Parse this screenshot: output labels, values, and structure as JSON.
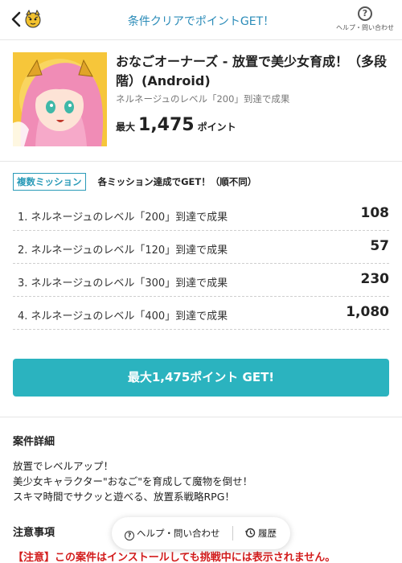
{
  "header": {
    "title": "条件クリアでポイントGET！",
    "help_icon_glyph": "?",
    "help_label": "ヘルプ・問い合わせ",
    "mascot_icon": "tiger-mascot-icon"
  },
  "app": {
    "title": "おなごオーナーズ - 放置で美少女育成！（多段階）(Android)",
    "subtitle": "ネルネージュのレベル「200」到達で成果",
    "max_prefix": "最大",
    "max_points": "1,475",
    "points_unit": "ポイント"
  },
  "missions": {
    "badge": "複数ミッション",
    "note": "各ミッション達成でGET！（順不同）",
    "items": [
      {
        "label": "1. ネルネージュのレベル「200」到達で成果",
        "points": "108"
      },
      {
        "label": "2. ネルネージュのレベル「120」到達で成果",
        "points": "57"
      },
      {
        "label": "3. ネルネージュのレベル「300」到達で成果",
        "points": "230"
      },
      {
        "label": "4. ネルネージュのレベル「400」到達で成果",
        "points": "1,080"
      }
    ]
  },
  "cta": {
    "label": "最大1,475ポイント GET!"
  },
  "details": {
    "title": "案件詳細",
    "lines": [
      "放置でレベルアップ！",
      "美少女キャラクター\"おなご\"を育成して魔物を倒せ！",
      "スキマ時間でサクッと遊べる、放置系戦略RPG！"
    ]
  },
  "notice": {
    "title": "注意事項",
    "warning": "【注意】この案件はインストールしても挑戦中には表示されません。"
  },
  "floatbar": {
    "help_label": "ヘルプ・問い合わせ",
    "history_label": "履歴"
  },
  "colors": {
    "accent": "#2bb3bf",
    "header_text": "#2a8bb8",
    "warning": "#d31c1c"
  }
}
